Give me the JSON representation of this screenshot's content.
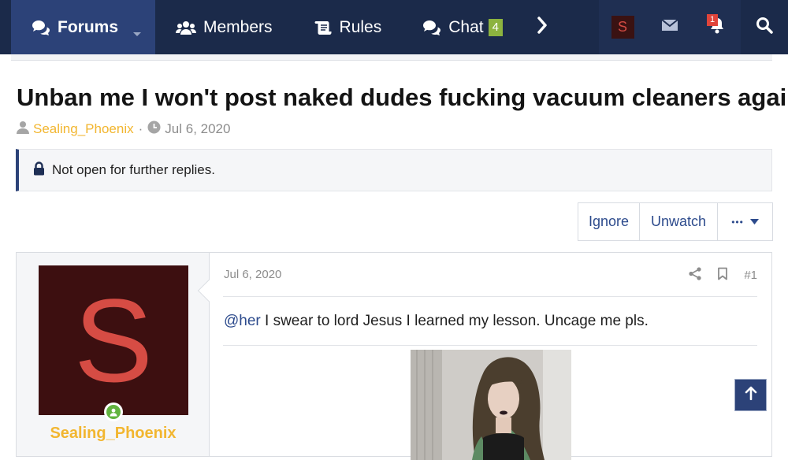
{
  "nav": {
    "tabs": [
      {
        "label": "Forums",
        "icon": "comments-icon",
        "active": true
      },
      {
        "label": "Members",
        "icon": "users-icon"
      },
      {
        "label": "Rules",
        "icon": "scroll-icon"
      },
      {
        "label": "Chat",
        "icon": "comments-icon",
        "badge": "4"
      }
    ],
    "user_avatar_letter": "S",
    "alerts_badge": "1",
    "colors": {
      "bar": "#1b2a4a",
      "active_tab": "#2c4278",
      "chat_badge": "#8cb33f",
      "alert_badge": "#e0443a"
    }
  },
  "thread": {
    "title": "Unban me I won't post naked dudes fucking vacuum cleaners again",
    "author": "Sealing_Phoenix",
    "separator": "·",
    "date": "Jul 6, 2020",
    "notice": "Not open for further replies."
  },
  "buttons": {
    "ignore": "Ignore",
    "unwatch": "Unwatch",
    "more": "•••"
  },
  "post": {
    "date": "Jul 6, 2020",
    "number": "#1",
    "mention": "@her",
    "body": " I swear to lord Jesus I learned my lesson. Uncage me pls.",
    "user": {
      "name": "Sealing_Phoenix",
      "avatar_letter": "S",
      "online": true
    }
  },
  "colors": {
    "link": "#2c4a8c",
    "username": "#f2b630",
    "avatar_bg": "#3d0f10",
    "avatar_fg": "#d64c44"
  }
}
